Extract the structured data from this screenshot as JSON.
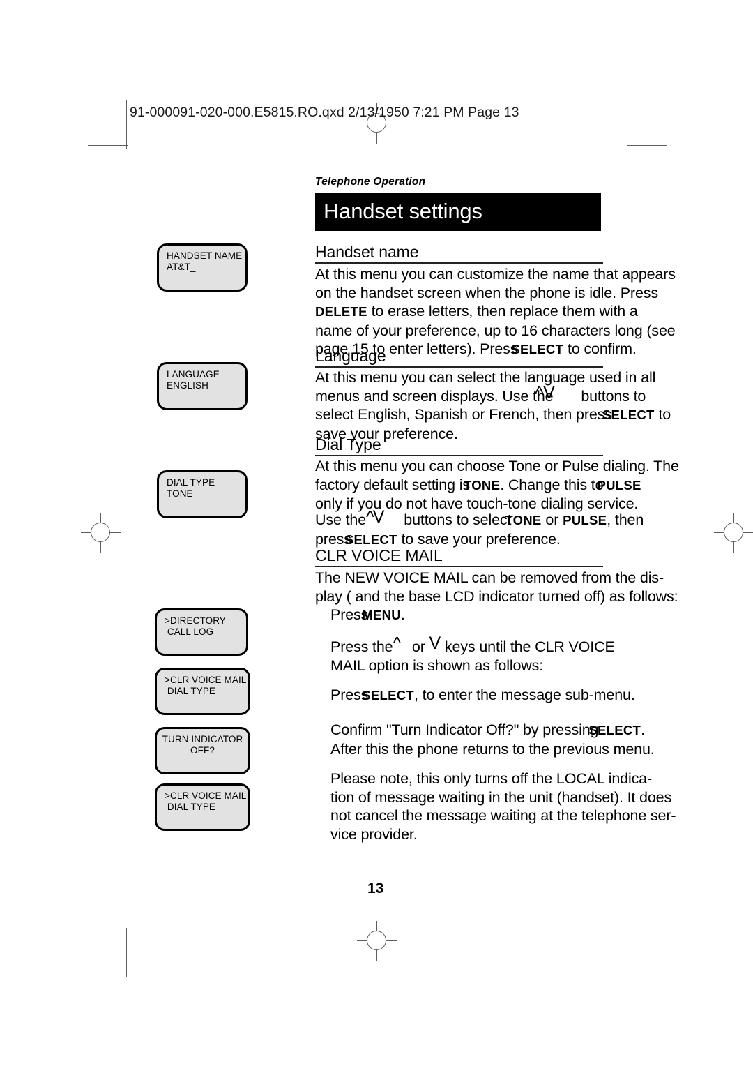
{
  "document": {
    "file_header": "91-000091-020-000.E5815.RO.qxd  2/13/1950  7:21 PM  Page 13",
    "running_head": "Telephone Operation",
    "banner_title": "Handset settings",
    "page_number": "13"
  },
  "sections": {
    "handset_name": {
      "heading": "Handset name",
      "lines": [
        "At this menu you can customize the name that appears",
        "on the handset screen when the phone is idle. Press",
        "to erase letters, then replace them with a",
        "name of your preference, up to 16 characters long (see",
        "page 15 to enter letters). Press",
        "to confirm."
      ],
      "kw_delete": "DELETE",
      "kw_select": "SELECT",
      "word_press": "Press"
    },
    "language": {
      "heading": "Language",
      "lines": [
        "At this menu you can select the language used in all",
        "menus and screen displays. Use the",
        "buttons to",
        "select English, Spanish or French, then press",
        "to",
        "save your preference."
      ],
      "kw_select": "SELECT",
      "arrows": "^V"
    },
    "dial_type": {
      "heading": "Dial Type",
      "p1": [
        "At this menu you can choose Tone or Pulse dialing. The",
        "factory default setting is",
        ". Change this to",
        "only if you do not have touch-tone dialing service."
      ],
      "p2_a": "Use the",
      "p2_b": "buttons to select",
      "p2_c": "or",
      "p2_d": ", then",
      "p2_e": "press",
      "p2_f": "to save your preference.",
      "kw_tone": "TONE",
      "kw_pulse": "PULSE",
      "kw_select": "SELECT",
      "arrows": "^V"
    },
    "clr_voice_mail": {
      "heading": "CLR VOICE MAIL",
      "intro": [
        "The NEW VOICE MAIL can be removed from the dis-",
        "play ( and the base LCD indicator turned off) as follows:"
      ],
      "step1_press": "Press",
      "step1_kw": "MENU",
      "step1_end": ".",
      "step2_a": "Press the",
      "step2_up": "^",
      "step2_or": "or",
      "step2_down": "V",
      "step2_b": "keys until the CLR VOICE",
      "step2_c": "MAIL option is shown as follows:",
      "step3_press": "Press",
      "step3_kw": "SELECT",
      "step3_end": ", to enter the message sub-menu.",
      "step4_a": "Confirm \"Turn Indicator Off?\" by pressing",
      "step4_kw": "SELECT",
      "step4_end": ".",
      "step4_b": "After this the phone returns to the previous menu.",
      "note": [
        "Please note,  this only turns off the LOCAL indica-",
        "tion of message waiting in the unit (handset).  It does",
        "not cancel the message waiting at the telephone ser-",
        "vice provider."
      ]
    }
  },
  "lcd_screens": [
    {
      "name": "handset-name-screen",
      "line1": "HANDSET NAME",
      "line2": "AT&T_",
      "align": "left"
    },
    {
      "name": "language-screen",
      "line1": "LANGUAGE",
      "line2": "ENGLISH",
      "align": "left"
    },
    {
      "name": "dial-type-screen",
      "line1": "DIAL TYPE",
      "line2": "TONE",
      "align": "left"
    },
    {
      "name": "directory-screen",
      "line1": ">DIRECTORY",
      "line2": " CALL LOG",
      "align": "left"
    },
    {
      "name": "clr-voice-mail-screen",
      "line1": ">CLR VOICE MAIL",
      "line2": " DIAL TYPE",
      "align": "left"
    },
    {
      "name": "turn-indicator-screen",
      "line1": "TURN INDICATOR",
      "line2": "OFF?",
      "align": "center"
    },
    {
      "name": "clr-voice-mail-screen-2",
      "line1": ">CLR VOICE MAIL",
      "line2": " DIAL TYPE",
      "align": "left"
    }
  ]
}
